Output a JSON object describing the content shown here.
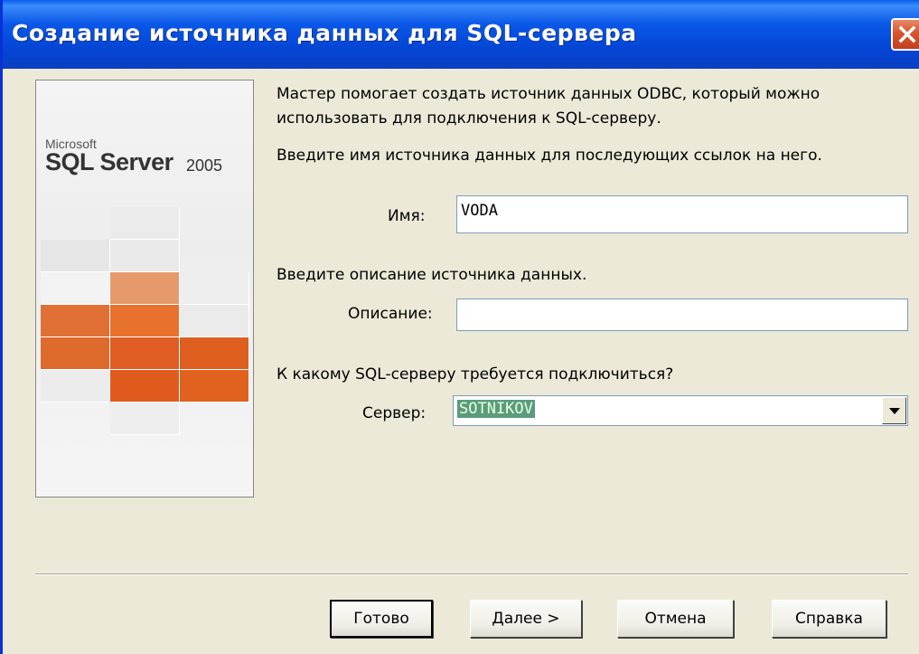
{
  "window": {
    "title": "Создание источника данных для SQL-сервера"
  },
  "banner": {
    "brand": "Microsoft",
    "product": "SQL Server",
    "version": "2005"
  },
  "intro": {
    "line1": "Мастер помогает создать источник данных ODBC, который можно",
    "line2": "использовать для подключения к SQL-серверу.",
    "name_prompt": "Введите имя источника данных для последующих ссылок на него."
  },
  "form": {
    "name_label": "Имя:",
    "name_value": "VODA",
    "desc_prompt": "Введите описание источника данных.",
    "desc_label": "Описание:",
    "desc_value": "",
    "server_prompt": "К какому SQL-серверу требуется подключиться?",
    "server_label": "Сервер:",
    "server_value": "SOTNIKOV"
  },
  "buttons": {
    "finish": "Готово",
    "next": "Далее >",
    "cancel": "Отмена",
    "help": "Справка"
  },
  "icons": {
    "close": "close-icon",
    "dropdown": "chevron-down-icon"
  }
}
